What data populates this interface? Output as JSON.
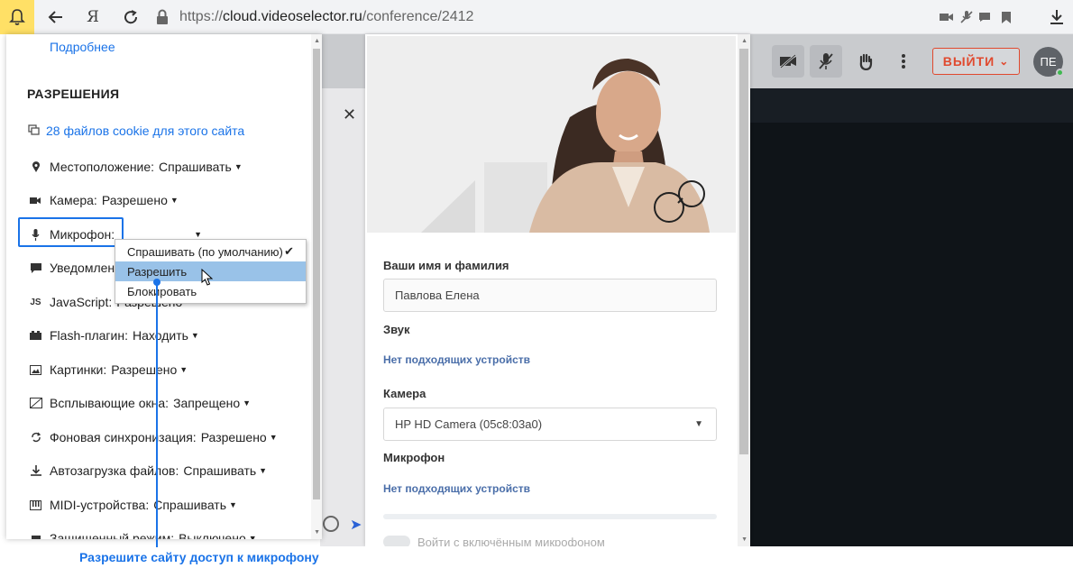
{
  "browser": {
    "url_scheme": "https://",
    "url_host": "cloud.videoselector.ru",
    "url_path": "/conference/2412",
    "yandex_label": "Я"
  },
  "conference": {
    "exit_label": "ВЫЙТИ",
    "exit_caret": "⌄",
    "avatar_initials": "ПЕ"
  },
  "site_settings": {
    "more_link": "Подробнее",
    "section_title": "РАЗРЕШЕНИЯ",
    "cookies_link": "28 файлов cookie для этого сайта",
    "permissions": [
      {
        "label": "Местоположение:",
        "value": "Спрашивать",
        "icon": "location-pin-icon"
      },
      {
        "label": "Камера:",
        "value": "Разрешено",
        "icon": "camera-icon"
      },
      {
        "label": "Микрофон:",
        "value": "",
        "icon": "microphone-icon"
      },
      {
        "label": "Уведомлен",
        "value": "",
        "icon": "notification-icon"
      },
      {
        "label": "JavaScript:",
        "value": "Разрешено",
        "icon": "javascript-icon"
      },
      {
        "label": "Flash-плагин:",
        "value": "Находить",
        "icon": "flash-plugin-icon"
      },
      {
        "label": "Картинки:",
        "value": "Разрешено",
        "icon": "image-icon"
      },
      {
        "label": "Всплывающие окна:",
        "value": "Запрещено",
        "icon": "popup-icon"
      },
      {
        "label": "Фоновая синхронизация:",
        "value": "Разрешено",
        "icon": "sync-icon"
      },
      {
        "label": "Автозагрузка файлов:",
        "value": "Спрашивать",
        "icon": "download-icon"
      },
      {
        "label": "MIDI-устройства:",
        "value": "Спрашивать",
        "icon": "midi-icon"
      },
      {
        "label": "Защищенный режим:",
        "value": "Выключено",
        "icon": "protected-mode-icon"
      }
    ],
    "mic_dropdown": {
      "options": [
        "Спрашивать (по умолчанию)",
        "Разрешить",
        "Блокировать"
      ],
      "checked": "Спрашивать (по умолчанию)",
      "highlighted": "Разрешить"
    }
  },
  "join_form": {
    "name_label": "Ваши имя и фамилия",
    "name_value": "Павлова Елена",
    "sound_label": "Звук",
    "sound_status": "Нет подходящих устройств",
    "camera_label": "Камера",
    "camera_value": "HP HD Camera (05c8:03a0)",
    "mic_label": "Микрофон",
    "mic_status": "Нет подходящих устройств",
    "join_with_mic_label": "Войти с включённым микрофоном"
  },
  "callout": {
    "text": "Разрешите сайту доступ к микрофону"
  },
  "colors": {
    "accent_blue": "#1a73e8",
    "exit_red": "#e0492e",
    "dropdown_highlight": "#99c2e8",
    "app_dark": "#0f1418"
  }
}
